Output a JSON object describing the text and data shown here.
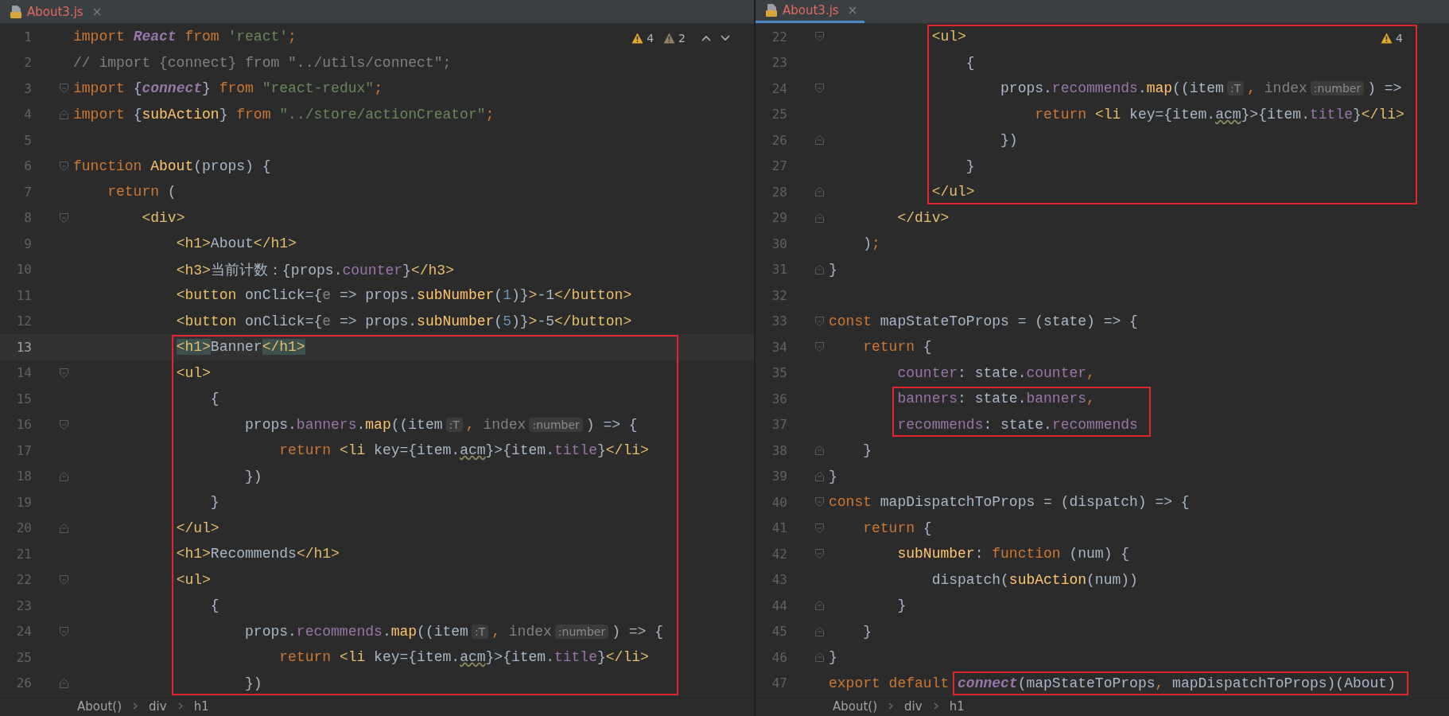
{
  "panes": [
    {
      "tabs": [
        {
          "label": "About3.js",
          "selected": false
        }
      ],
      "inspections": [
        {
          "kind": "warning",
          "count": "4"
        },
        {
          "kind": "weak",
          "count": "2"
        }
      ],
      "nav_arrows": true,
      "blocks": [
        {
          "boxed": false,
          "lines": [
            {
              "n": "1",
              "kind": "plain",
              "current": false,
              "t": [
                {
                  "kind": "kw",
                  "text": "import "
                },
                {
                  "kind": "ital",
                  "text": "React"
                },
                {
                  "kind": "kw",
                  "text": " from "
                },
                {
                  "kind": "str",
                  "text": "'react'"
                },
                {
                  "kind": "kw",
                  "text": ";"
                }
              ]
            },
            {
              "n": "2",
              "kind": "plain",
              "current": false,
              "t": [
                {
                  "kind": "comment",
                  "text": "// import {connect} from \"../utils/connect\";"
                }
              ]
            },
            {
              "n": "3",
              "kind": "start",
              "current": false,
              "t": [
                {
                  "kind": "kw",
                  "text": "import "
                },
                {
                  "kind": "plain",
                  "text": "{"
                },
                {
                  "kind": "ital",
                  "text": "connect"
                },
                {
                  "kind": "plain",
                  "text": "} "
                },
                {
                  "kind": "kw",
                  "text": "from "
                },
                {
                  "kind": "str",
                  "text": "\"react-redux\""
                },
                {
                  "kind": "kw",
                  "text": ";"
                }
              ]
            },
            {
              "n": "4",
              "kind": "end",
              "current": false,
              "t": [
                {
                  "kind": "kw",
                  "text": "import "
                },
                {
                  "kind": "plain",
                  "text": "{"
                },
                {
                  "kind": "fn",
                  "text": "subAction"
                },
                {
                  "kind": "plain",
                  "text": "} "
                },
                {
                  "kind": "kw",
                  "text": "from "
                },
                {
                  "kind": "str",
                  "text": "\"../store/actionCreator\""
                },
                {
                  "kind": "kw",
                  "text": ";"
                }
              ]
            },
            {
              "n": "5",
              "kind": "plain",
              "current": false
            },
            {
              "n": "6",
              "kind": "start",
              "current": false,
              "t": [
                {
                  "kind": "kw",
                  "text": "function "
                },
                {
                  "kind": "fn",
                  "text": "About"
                },
                {
                  "kind": "plain",
                  "text": "(props) {"
                }
              ]
            },
            {
              "n": "7",
              "kind": "plain",
              "current": false,
              "t": [
                {
                  "kind": "kw",
                  "text": "    return "
                },
                {
                  "kind": "plain",
                  "text": "("
                }
              ]
            },
            {
              "n": "8",
              "kind": "start",
              "current": false,
              "t": [
                {
                  "kind": "tag",
                  "text": "        <div>"
                }
              ]
            },
            {
              "n": "9",
              "kind": "plain",
              "current": false,
              "t": [
                {
                  "kind": "tag",
                  "text": "            <h1>"
                },
                {
                  "kind": "plain",
                  "text": "About"
                },
                {
                  "kind": "tag",
                  "text": "</h1>"
                }
              ]
            },
            {
              "n": "10",
              "kind": "plain",
              "current": false,
              "t": [
                {
                  "kind": "tag",
                  "text": "            <h3>"
                },
                {
                  "kind": "plain",
                  "text": "当前计数：{props."
                },
                {
                  "kind": "prop",
                  "text": "counter"
                },
                {
                  "kind": "plain",
                  "text": "}"
                },
                {
                  "kind": "tag",
                  "text": "</h3>"
                }
              ]
            },
            {
              "n": "11",
              "kind": "plain",
              "current": false,
              "t": [
                {
                  "kind": "tag",
                  "text": "            <button "
                },
                {
                  "kind": "plain",
                  "text": "onClick={"
                },
                {
                  "kind": "dim",
                  "text": "e"
                },
                {
                  "kind": "plain",
                  "text": " => props."
                },
                {
                  "kind": "fn",
                  "text": "subNumber"
                },
                {
                  "kind": "plain",
                  "text": "("
                },
                {
                  "kind": "num",
                  "text": "1"
                },
                {
                  "kind": "plain",
                  "text": ")}"
                },
                {
                  "kind": "tag",
                  "text": ">"
                },
                {
                  "kind": "plain",
                  "text": "-1"
                },
                {
                  "kind": "tag",
                  "text": "</button>"
                }
              ]
            },
            {
              "n": "12",
              "kind": "plain",
              "current": false,
              "t": [
                {
                  "kind": "tag",
                  "text": "            <button "
                },
                {
                  "kind": "plain",
                  "text": "onClick={"
                },
                {
                  "kind": "dim",
                  "text": "e"
                },
                {
                  "kind": "plain",
                  "text": " => props."
                },
                {
                  "kind": "fn",
                  "text": "subNumber"
                },
                {
                  "kind": "plain",
                  "text": "("
                },
                {
                  "kind": "num",
                  "text": "5"
                },
                {
                  "kind": "plain",
                  "text": ")}"
                },
                {
                  "kind": "tag",
                  "text": ">"
                },
                {
                  "kind": "plain",
                  "text": "-5"
                },
                {
                  "kind": "tag",
                  "text": "</button>"
                }
              ]
            }
          ]
        },
        {
          "boxed": true,
          "lines": [
            {
              "n": "13",
              "kind": "plain",
              "current": true,
              "t": [
                {
                  "kind": "match",
                  "text": "            <h1>"
                },
                {
                  "kind": "plain",
                  "text": "Banner"
                },
                {
                  "kind": "match",
                  "text": "</h1>"
                }
              ]
            },
            {
              "n": "14",
              "kind": "start",
              "current": false,
              "t": [
                {
                  "kind": "tag",
                  "text": "            <ul>"
                }
              ]
            },
            {
              "n": "15",
              "kind": "plain",
              "current": false,
              "t": [
                {
                  "kind": "plain",
                  "text": "                {"
                }
              ]
            },
            {
              "n": "16",
              "kind": "start",
              "current": false,
              "t": [
                {
                  "kind": "plain",
                  "text": "                    props."
                },
                {
                  "kind": "prop",
                  "text": "banners"
                },
                {
                  "kind": "plain",
                  "text": "."
                },
                {
                  "kind": "fn",
                  "text": "map"
                },
                {
                  "kind": "plain",
                  "text": "((item"
                },
                {
                  "kind": "hint",
                  "text": ":T"
                },
                {
                  "kind": "kw",
                  "text": ", "
                },
                {
                  "kind": "dim",
                  "text": "index"
                },
                {
                  "kind": "hint",
                  "text": ":number"
                },
                {
                  "kind": "plain",
                  "text": ") => {"
                }
              ]
            },
            {
              "n": "17",
              "kind": "plain",
              "current": false,
              "t": [
                {
                  "kind": "kw",
                  "text": "                        return "
                },
                {
                  "kind": "tag",
                  "text": "<li "
                },
                {
                  "kind": "plain",
                  "text": "key={item."
                },
                {
                  "kind": "warn",
                  "text": "acm"
                },
                {
                  "kind": "plain",
                  "text": "}>{item."
                },
                {
                  "kind": "prop",
                  "text": "title"
                },
                {
                  "kind": "plain",
                  "text": "}"
                },
                {
                  "kind": "tag",
                  "text": "</li>"
                }
              ]
            },
            {
              "n": "18",
              "kind": "end",
              "current": false,
              "t": [
                {
                  "kind": "plain",
                  "text": "                    })"
                }
              ]
            },
            {
              "n": "19",
              "kind": "plain",
              "current": false,
              "t": [
                {
                  "kind": "plain",
                  "text": "                }"
                }
              ]
            },
            {
              "n": "20",
              "kind": "end",
              "current": false,
              "t": [
                {
                  "kind": "tag",
                  "text": "            </ul>"
                }
              ]
            },
            {
              "n": "21",
              "kind": "plain",
              "current": false,
              "t": [
                {
                  "kind": "tag",
                  "text": "            <h1>"
                },
                {
                  "kind": "plain",
                  "text": "Recommends"
                },
                {
                  "kind": "tag",
                  "text": "</h1>"
                }
              ]
            },
            {
              "n": "22",
              "kind": "start",
              "current": false,
              "t": [
                {
                  "kind": "tag",
                  "text": "            <ul>"
                }
              ]
            },
            {
              "n": "23",
              "kind": "plain",
              "current": false,
              "t": [
                {
                  "kind": "plain",
                  "text": "                {"
                }
              ]
            },
            {
              "n": "24",
              "kind": "start",
              "current": false,
              "t": [
                {
                  "kind": "plain",
                  "text": "                    props."
                },
                {
                  "kind": "prop",
                  "text": "recommends"
                },
                {
                  "kind": "plain",
                  "text": "."
                },
                {
                  "kind": "fn",
                  "text": "map"
                },
                {
                  "kind": "plain",
                  "text": "((item"
                },
                {
                  "kind": "hint",
                  "text": ":T"
                },
                {
                  "kind": "kw",
                  "text": ", "
                },
                {
                  "kind": "dim",
                  "text": "index"
                },
                {
                  "kind": "hint",
                  "text": ":number"
                },
                {
                  "kind": "plain",
                  "text": ") => {"
                }
              ]
            },
            {
              "n": "25",
              "kind": "plain",
              "current": false,
              "t": [
                {
                  "kind": "kw",
                  "text": "                        return "
                },
                {
                  "kind": "tag",
                  "text": "<li "
                },
                {
                  "kind": "plain",
                  "text": "key={item."
                },
                {
                  "kind": "warn",
                  "text": "acm"
                },
                {
                  "kind": "plain",
                  "text": "}>{item."
                },
                {
                  "kind": "prop",
                  "text": "title"
                },
                {
                  "kind": "plain",
                  "text": "}"
                },
                {
                  "kind": "tag",
                  "text": "</li>"
                }
              ]
            },
            {
              "n": "26",
              "kind": "end",
              "current": false,
              "t": [
                {
                  "kind": "plain",
                  "text": "                    })"
                }
              ]
            }
          ]
        }
      ],
      "breadcrumbs": [
        "About()",
        "div",
        "h1"
      ]
    },
    {
      "tabs": [
        {
          "label": "About3.js",
          "selected": true
        }
      ],
      "inspections": [
        {
          "kind": "warning",
          "count": "4"
        }
      ],
      "nav_arrows": false,
      "blocks": [
        {
          "boxed": true,
          "lines": [
            {
              "n": "22",
              "kind": "start",
              "current": false,
              "t": [
                {
                  "kind": "tag",
                  "text": "            <ul>"
                }
              ]
            },
            {
              "n": "23",
              "kind": "plain",
              "current": false,
              "t": [
                {
                  "kind": "plain",
                  "text": "                {"
                }
              ]
            },
            {
              "n": "24",
              "kind": "start",
              "current": false,
              "t": [
                {
                  "kind": "plain",
                  "text": "                    props."
                },
                {
                  "kind": "prop",
                  "text": "recommends"
                },
                {
                  "kind": "plain",
                  "text": "."
                },
                {
                  "kind": "fn",
                  "text": "map"
                },
                {
                  "kind": "plain",
                  "text": "((item"
                },
                {
                  "kind": "hint",
                  "text": ":T"
                },
                {
                  "kind": "kw",
                  "text": ", "
                },
                {
                  "kind": "dim",
                  "text": "index"
                },
                {
                  "kind": "hint",
                  "text": ":number"
                },
                {
                  "kind": "plain",
                  "text": ") =>"
                }
              ]
            },
            {
              "n": "25",
              "kind": "plain",
              "current": false,
              "t": [
                {
                  "kind": "kw",
                  "text": "                        return "
                },
                {
                  "kind": "tag",
                  "text": "<li "
                },
                {
                  "kind": "plain",
                  "text": "key={item."
                },
                {
                  "kind": "warn",
                  "text": "acm"
                },
                {
                  "kind": "plain",
                  "text": "}>{item."
                },
                {
                  "kind": "prop",
                  "text": "title"
                },
                {
                  "kind": "plain",
                  "text": "}"
                },
                {
                  "kind": "tag",
                  "text": "</li>"
                }
              ]
            },
            {
              "n": "26",
              "kind": "end",
              "current": false,
              "t": [
                {
                  "kind": "plain",
                  "text": "                    })"
                }
              ]
            },
            {
              "n": "27",
              "kind": "plain",
              "current": false,
              "t": [
                {
                  "kind": "plain",
                  "text": "                }"
                }
              ]
            },
            {
              "n": "28",
              "kind": "end",
              "current": false,
              "t": [
                {
                  "kind": "tag",
                  "text": "            </ul>"
                }
              ]
            }
          ]
        },
        {
          "boxed": false,
          "lines": [
            {
              "n": "29",
              "kind": "end",
              "current": false,
              "t": [
                {
                  "kind": "tag",
                  "text": "        </div>"
                }
              ]
            },
            {
              "n": "30",
              "kind": "plain",
              "current": false,
              "t": [
                {
                  "kind": "plain",
                  "text": "    )"
                },
                {
                  "kind": "kw",
                  "text": ";"
                }
              ]
            },
            {
              "n": "31",
              "kind": "end",
              "current": false,
              "t": [
                {
                  "kind": "plain",
                  "text": "}"
                }
              ]
            },
            {
              "n": "32",
              "kind": "plain",
              "current": false
            },
            {
              "n": "33",
              "kind": "start",
              "current": false,
              "t": [
                {
                  "kind": "kw",
                  "text": "const "
                },
                {
                  "kind": "plain",
                  "text": "mapStateToProps = (state) => {"
                }
              ]
            },
            {
              "n": "34",
              "kind": "start",
              "current": false,
              "t": [
                {
                  "kind": "kw",
                  "text": "    return "
                },
                {
                  "kind": "plain",
                  "text": "{"
                }
              ]
            },
            {
              "n": "35",
              "kind": "plain",
              "current": false,
              "t": [
                {
                  "kind": "prop",
                  "text": "        counter"
                },
                {
                  "kind": "plain",
                  "text": ": state."
                },
                {
                  "kind": "prop",
                  "text": "counter"
                },
                {
                  "kind": "kw",
                  "text": ","
                }
              ]
            }
          ]
        },
        {
          "boxed": true,
          "lines": [
            {
              "n": "36",
              "kind": "plain",
              "current": false,
              "t": [
                {
                  "kind": "prop",
                  "text": "        banners"
                },
                {
                  "kind": "plain",
                  "text": ": state."
                },
                {
                  "kind": "prop",
                  "text": "banners"
                },
                {
                  "kind": "kw",
                  "text": ","
                }
              ]
            },
            {
              "n": "37",
              "kind": "plain",
              "current": false,
              "t": [
                {
                  "kind": "prop",
                  "text": "        recommends"
                },
                {
                  "kind": "plain",
                  "text": ": state."
                },
                {
                  "kind": "prop",
                  "text": "recommends"
                }
              ]
            }
          ]
        },
        {
          "boxed": false,
          "lines": [
            {
              "n": "38",
              "kind": "end",
              "current": false,
              "t": [
                {
                  "kind": "plain",
                  "text": "    }"
                }
              ]
            },
            {
              "n": "39",
              "kind": "end",
              "current": false,
              "t": [
                {
                  "kind": "plain",
                  "text": "}"
                }
              ]
            },
            {
              "n": "40",
              "kind": "start",
              "current": false,
              "t": [
                {
                  "kind": "kw",
                  "text": "const "
                },
                {
                  "kind": "plain",
                  "text": "mapDispatchToProps = (dispatch) => {"
                }
              ]
            },
            {
              "n": "41",
              "kind": "start",
              "current": false,
              "t": [
                {
                  "kind": "kw",
                  "text": "    return "
                },
                {
                  "kind": "plain",
                  "text": "{"
                }
              ]
            },
            {
              "n": "42",
              "kind": "start",
              "current": false,
              "t": [
                {
                  "kind": "fn",
                  "text": "        subNumber"
                },
                {
                  "kind": "plain",
                  "text": ": "
                },
                {
                  "kind": "kw",
                  "text": "function "
                },
                {
                  "kind": "plain",
                  "text": "(num) {"
                }
              ]
            },
            {
              "n": "43",
              "kind": "plain",
              "current": false,
              "t": [
                {
                  "kind": "plain",
                  "text": "            dispatch("
                },
                {
                  "kind": "fn",
                  "text": "subAction"
                },
                {
                  "kind": "plain",
                  "text": "(num))"
                }
              ]
            },
            {
              "n": "44",
              "kind": "end",
              "current": false,
              "t": [
                {
                  "kind": "plain",
                  "text": "        }"
                }
              ]
            },
            {
              "n": "45",
              "kind": "end",
              "current": false,
              "t": [
                {
                  "kind": "plain",
                  "text": "    }"
                }
              ]
            },
            {
              "n": "46",
              "kind": "end",
              "current": false,
              "t": [
                {
                  "kind": "plain",
                  "text": "}"
                }
              ]
            }
          ]
        },
        {
          "boxed": true,
          "lines": [
            {
              "n": "47",
              "kind": "plain",
              "current": false,
              "pre": [
                {
                  "kind": "kw",
                  "text": "export default "
                }
              ],
              "t": [
                {
                  "kind": "ital",
                  "text": "connect"
                },
                {
                  "kind": "plain",
                  "text": "(mapStateToProps"
                },
                {
                  "kind": "kw",
                  "text": ", "
                },
                {
                  "kind": "plain",
                  "text": "mapDispatchToProps)(About)"
                }
              ]
            }
          ]
        }
      ],
      "breadcrumbs": [
        "About()",
        "div",
        "h1"
      ]
    }
  ]
}
